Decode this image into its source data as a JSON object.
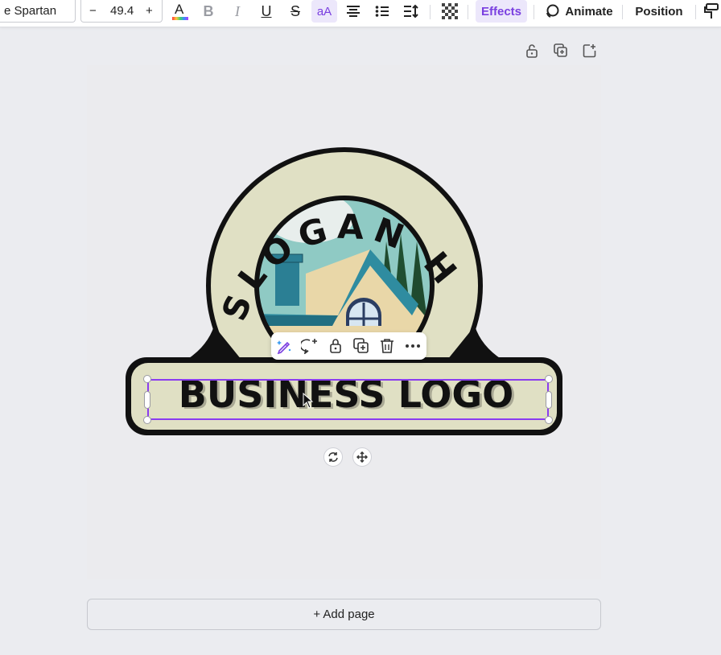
{
  "toolbar": {
    "font_name": "e Spartan",
    "font_size": "49.4",
    "decrease_label": "−",
    "increase_label": "+",
    "text_color_letter": "A",
    "bold_label": "B",
    "italic_label": "I",
    "underline_label": "U",
    "strike_label": "S",
    "case_label": "aA",
    "effects_label": "Effects",
    "animate_label": "Animate",
    "position_label": "Position"
  },
  "canvas": {
    "slogan_text": "SLOGAN HERE",
    "business_text": "BUSINESS LOGO"
  },
  "add_page_label": "+ Add page",
  "colors": {
    "accent": "#8b3cf0",
    "badge_fill": "#e0e0c4",
    "outline": "#111111",
    "sky": "#8fcac4",
    "roof": "#2f8ca0"
  },
  "icons": [
    "lock-icon",
    "duplicate-icon",
    "add-page-icon",
    "magic-edit-icon",
    "comment-icon",
    "copy-icon",
    "trash-icon",
    "more-icon",
    "rotate-icon",
    "move-icon"
  ]
}
